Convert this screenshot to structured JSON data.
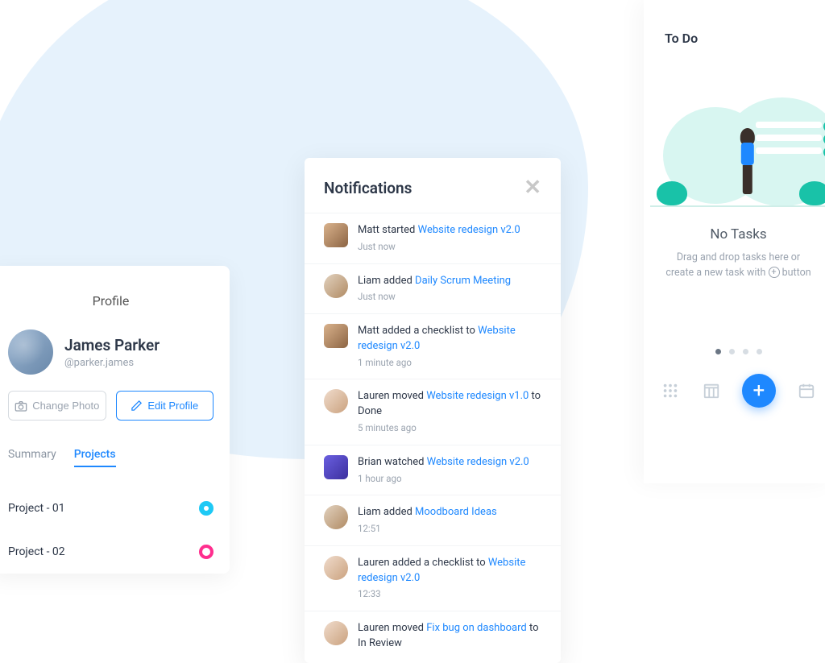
{
  "profile": {
    "header": "Profile",
    "name": "James Parker",
    "handle": "@parker.james",
    "change_photo_label": "Change Photo",
    "edit_profile_label": "Edit Profile",
    "tabs": {
      "summary": "Summary",
      "projects": "Projects"
    },
    "projects": [
      {
        "label": "Project - 01",
        "color": "cyan"
      },
      {
        "label": "Project - 02",
        "color": "pink"
      }
    ]
  },
  "notifications": {
    "title": "Notifications",
    "items": [
      {
        "prefix": "Matt started ",
        "link": "Website redesign v2.0",
        "suffix": "",
        "time": "Just now"
      },
      {
        "prefix": "Liam added ",
        "link": "Daily Scrum Meeting",
        "suffix": "",
        "time": "Just now"
      },
      {
        "prefix": "Matt added a checklist to ",
        "link": "Website redesign v2.0",
        "suffix": "",
        "time": "1 minute ago"
      },
      {
        "prefix": "Lauren moved ",
        "link": "Website redesign v1.0",
        "suffix": " to Done",
        "time": "5 minutes ago"
      },
      {
        "prefix": "Brian watched ",
        "link": "Website redesign v2.0",
        "suffix": "",
        "time": "1 hour ago"
      },
      {
        "prefix": "Liam added ",
        "link": "Moodboard Ideas",
        "suffix": "",
        "time": "12:51"
      },
      {
        "prefix": "Lauren added a checklist to ",
        "link": "Website redesign v2.0",
        "suffix": "",
        "time": "12:33"
      },
      {
        "prefix": "Lauren moved ",
        "link": "Fix bug on dashboard",
        "suffix": " to In Review",
        "time": ""
      }
    ]
  },
  "todo": {
    "title": "To Do",
    "empty_title": "No Tasks",
    "empty_sub_1": "Drag and drop tasks here or",
    "empty_sub_2": "create a new task with",
    "empty_sub_3": "button"
  }
}
